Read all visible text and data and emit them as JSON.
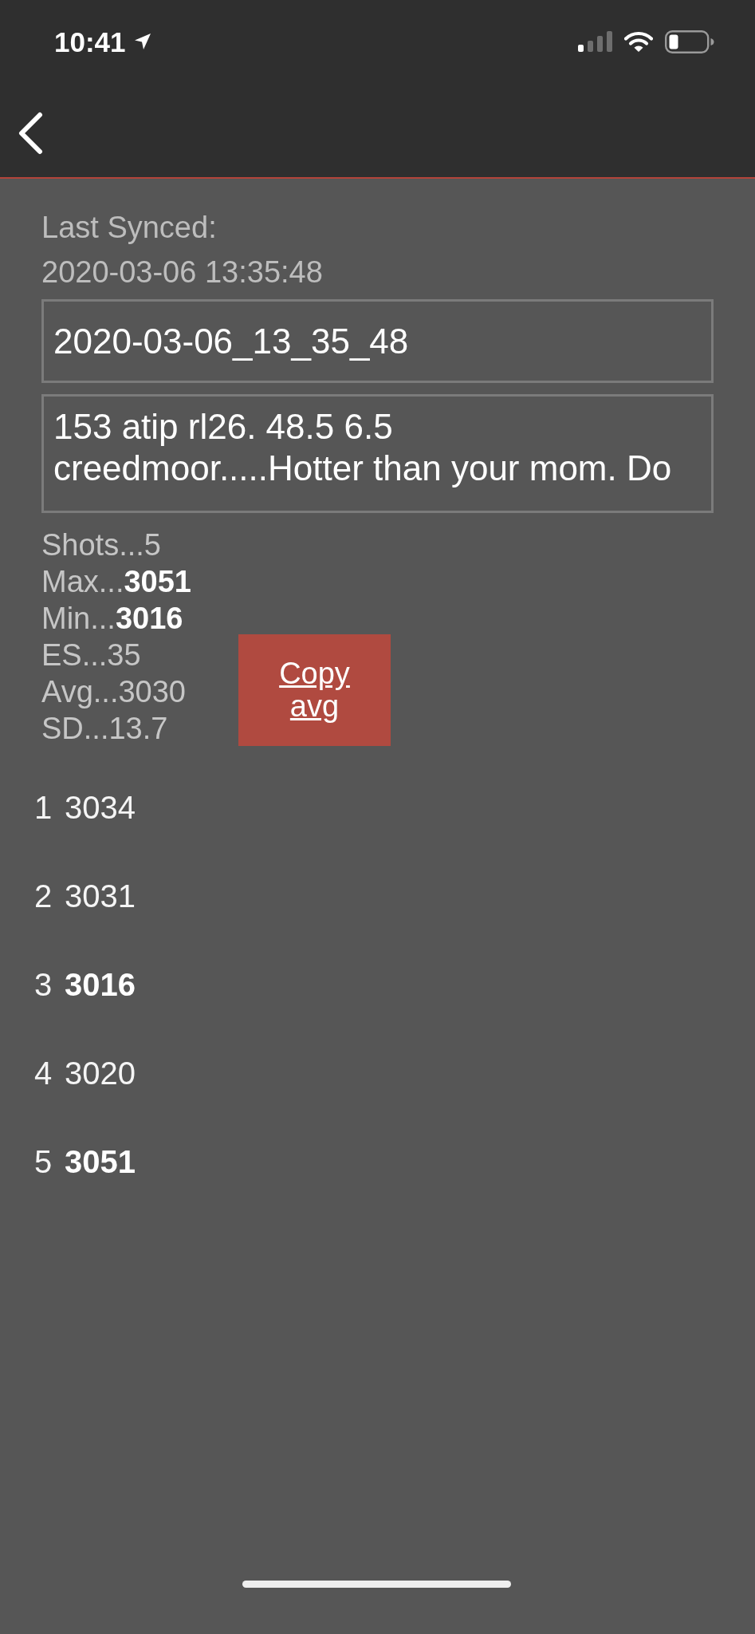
{
  "status_bar": {
    "time": "10:41"
  },
  "sync": {
    "label": "Last Synced:",
    "timestamp": "2020-03-06 13:35:48"
  },
  "name_field": {
    "value": "2020-03-06_13_35_48"
  },
  "notes_field": {
    "value": "153 atip rl26. 48.5 6.5 creedmoor.....Hotter than your mom. Do"
  },
  "stats": [
    "Shots...5",
    "Max...**3051**",
    "Min...**3016**",
    "ES...35",
    "Avg...3030",
    "SD...13.7"
  ],
  "copy_button": {
    "label": "Copy avg"
  },
  "shots": [
    {
      "number": "1",
      "velocity": "3034",
      "highlighted": false
    },
    {
      "number": "2",
      "velocity": "3031",
      "highlighted": false
    },
    {
      "number": "3",
      "velocity": "3016",
      "highlighted": true
    },
    {
      "number": "4",
      "velocity": "3020",
      "highlighted": false
    },
    {
      "number": "5",
      "velocity": "3051",
      "highlighted": true
    }
  ]
}
